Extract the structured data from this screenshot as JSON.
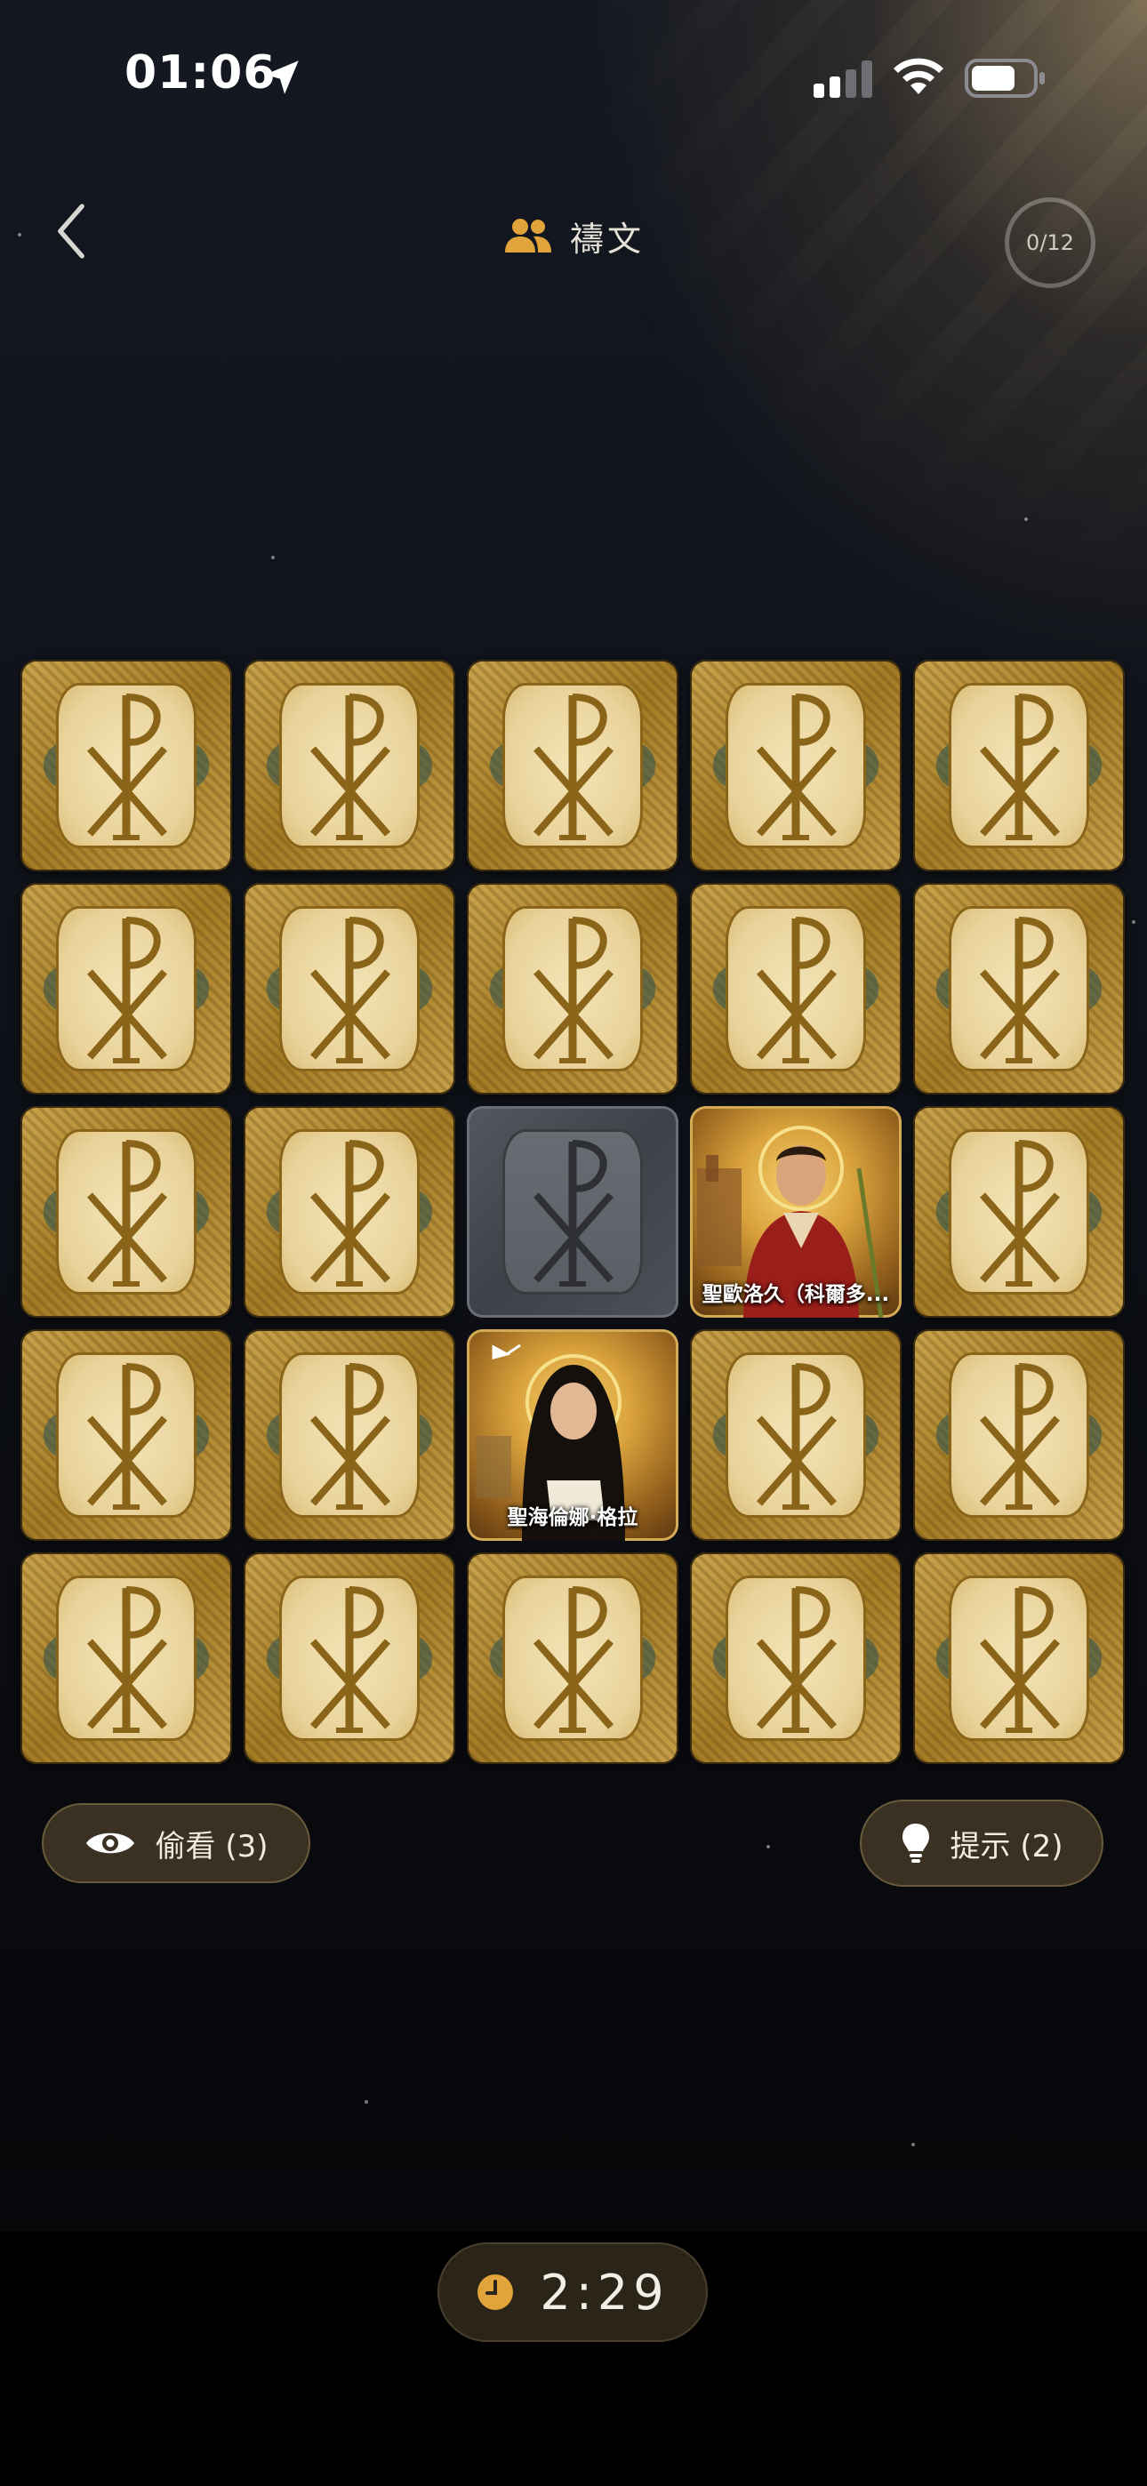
{
  "status_bar": {
    "time": "01:06",
    "icons": [
      "location-arrow-icon",
      "cellular-signal-icon",
      "wifi-icon",
      "battery-icon"
    ]
  },
  "header": {
    "title": "禱文",
    "title_icon": "people-icon",
    "progress": "0/12",
    "back_icon": "chevron-left-icon"
  },
  "board": {
    "columns": 5,
    "rows": 5,
    "cards": [
      {
        "state": "back"
      },
      {
        "state": "back"
      },
      {
        "state": "back"
      },
      {
        "state": "back"
      },
      {
        "state": "back"
      },
      {
        "state": "back"
      },
      {
        "state": "back"
      },
      {
        "state": "back"
      },
      {
        "state": "back"
      },
      {
        "state": "back"
      },
      {
        "state": "back"
      },
      {
        "state": "back"
      },
      {
        "state": "matched"
      },
      {
        "state": "face",
        "label": "聖歐洛久（科爾多..."
      },
      {
        "state": "back"
      },
      {
        "state": "back"
      },
      {
        "state": "back"
      },
      {
        "state": "face",
        "label": "聖海倫娜·格拉"
      },
      {
        "state": "back"
      },
      {
        "state": "back"
      },
      {
        "state": "back"
      },
      {
        "state": "back"
      },
      {
        "state": "back"
      },
      {
        "state": "back"
      },
      {
        "state": "back"
      }
    ]
  },
  "actions": {
    "peek": {
      "label": "偷看 (3)",
      "icon": "eye-icon"
    },
    "hint": {
      "label": "提示 (2)",
      "icon": "lightbulb-icon"
    }
  },
  "timer": {
    "value": "2:29",
    "icon": "clock-icon"
  },
  "colors": {
    "gold": "#c9a44c",
    "accent": "#e0a43a",
    "pill_bg": "#3a3122"
  }
}
